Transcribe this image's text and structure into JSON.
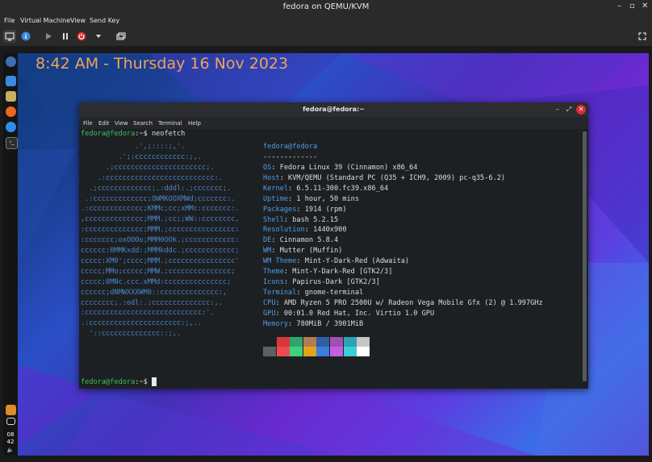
{
  "window": {
    "title": "fedora on QEMU/KVM"
  },
  "menu": [
    "File",
    "Virtual Machine",
    "View",
    "Send Key"
  ],
  "toolbar": [
    "monitor-icon",
    "info-icon",
    "play-icon",
    "pause-icon",
    "power-icon",
    "chevron-down-icon",
    "screenshot-icon"
  ],
  "desktop": {
    "clock": "8:42 AM - Thursday 16 Nov 2023"
  },
  "tray": {
    "time_hour": "08",
    "time_min": "42"
  },
  "terminal": {
    "title": "fedora@fedora:~",
    "menu": [
      "File",
      "Edit",
      "View",
      "Search",
      "Terminal",
      "Help"
    ],
    "prompt": "fedora@fedora",
    "prompt_suffix": ":~$ ",
    "command": "neofetch",
    "user_host": "fedora@fedora",
    "separator": "-------------",
    "logo": [
      "             .',;::::;,'.",
      "         .';:cccccccccccc:;,.",
      "      .;cccccccccccccccccccccc;.",
      "    .:cccccccccccccccccccccccccc:.",
      "  .;ccccccccccccc;.:dddl:.;ccccccc;.",
      " .:ccccccccccccc;OWMKOOXMWd;ccccccc:.",
      ".:ccccccccccccc;KMMc;cc;xMMc:ccccccc:.",
      ",cccccccccccccc;MMM.;cc;;WW::cccccccc,",
      ":cccccccccccccc;MMM.;cccccccccccccccc:",
      ":ccccccc;oxOOOo;MMM0OOk.;cccccccccccc:",
      "cccccc:0MMKxdd:;MMMkddc.;cccccccccccc;",
      "ccccc:XM0';cccc;MMM.;cccccccccccccccc'",
      "ccccc;MMo;ccccc;MMW.;ccccccccccccccc;",
      "ccccc;0MNc.ccc.xMMd:ccccccccccccccc;",
      "cccccc;dNMWXXXWM0::cccccccccccccc:,",
      "cccccccc;.:odl:.;cccccccccccccc:,.",
      ":cccccccccccccccccccccccccccc:'.",
      ".:cccccccccccccccccccccc:;,..",
      "  '::cccccccccccccc::;,."
    ],
    "info": [
      {
        "key": "OS",
        "value": "Fedora Linux 39 (Cinnamon) x86_64"
      },
      {
        "key": "Host",
        "value": "KVM/QEMU (Standard PC (Q35 + ICH9, 2009) pc-q35-6.2)"
      },
      {
        "key": "Kernel",
        "value": "6.5.11-300.fc39.x86_64"
      },
      {
        "key": "Uptime",
        "value": "1 hour, 50 mins"
      },
      {
        "key": "Packages",
        "value": "1914 (rpm)"
      },
      {
        "key": "Shell",
        "value": "bash 5.2.15"
      },
      {
        "key": "Resolution",
        "value": "1440x900"
      },
      {
        "key": "DE",
        "value": "Cinnamon 5.8.4"
      },
      {
        "key": "WM",
        "value": "Mutter (Muffin)"
      },
      {
        "key": "WM Theme",
        "value": "Mint-Y-Dark-Red (Adwaita)"
      },
      {
        "key": "Theme",
        "value": "Mint-Y-Dark-Red [GTK2/3]"
      },
      {
        "key": "Icons",
        "value": "Papirus-Dark [GTK2/3]"
      },
      {
        "key": "Terminal",
        "value": "gnome-terminal"
      },
      {
        "key": "CPU",
        "value": "AMD Ryzen 5 PRO 2500U w/ Radeon Vega Mobile Gfx (2) @ 1.997GHz"
      },
      {
        "key": "GPU",
        "value": "00:01.0 Red Hat, Inc. Virtio 1.0 GPU"
      },
      {
        "key": "Memory",
        "value": "780MiB / 3901MiB"
      }
    ],
    "palette_top": [
      "#1d2023",
      "#d9363e",
      "#2fa56a",
      "#b57a52",
      "#2d5fa3",
      "#a14fb5",
      "#2aa3b3",
      "#c7c7c7"
    ],
    "palette_bottom": [
      "#5d6066",
      "#ee4a50",
      "#3cd17f",
      "#e0a51d",
      "#3b7fd9",
      "#c261de",
      "#3bcdd8",
      "#ffffff"
    ]
  }
}
